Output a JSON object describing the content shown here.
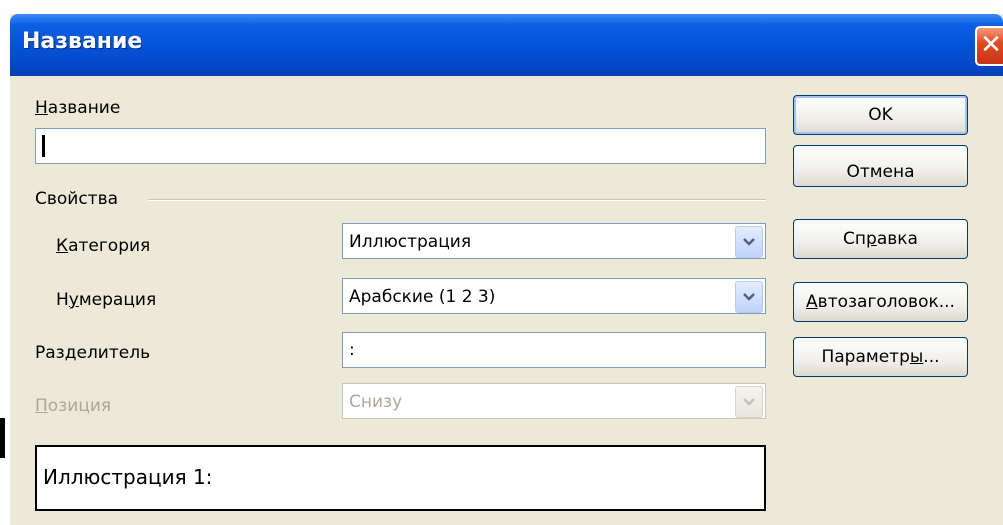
{
  "dialog": {
    "title": "Название",
    "close_glyph": "✕"
  },
  "name_field": {
    "label_underlined": "Н",
    "label_rest": "азвание",
    "value": ""
  },
  "properties": {
    "group_label": "Свойства",
    "category": {
      "label_underlined": "К",
      "label_rest": "атегория",
      "value": "Иллюстрация"
    },
    "numbering": {
      "label_pre": "Н",
      "label_underlined": "у",
      "label_rest": "мерация",
      "value": "Арабские (1 2 3)"
    },
    "separator": {
      "label_pre": "Раз",
      "label_underlined": "д",
      "label_rest": "елитель",
      "value": ":"
    },
    "position": {
      "label_underlined": "П",
      "label_rest": "озиция",
      "value": "Снизу"
    }
  },
  "preview_text": "Иллюстрация 1:",
  "buttons": {
    "ok": "OK",
    "cancel": "Отмена",
    "help_pre": "Сп",
    "help_underlined": "р",
    "help_rest": "авка",
    "autocaption_underlined": "А",
    "autocaption_rest": "втозаголовок...",
    "options_pre": "Параметр",
    "options_underlined": "ы",
    "options_rest": "..."
  },
  "icons": {
    "close": "close-icon",
    "dropdown": "chevron-down-icon"
  },
  "colors": {
    "titlebar": "#0553d8",
    "dialog_bg": "#ece9d8",
    "close_button": "#e24c22",
    "button_border": "#003c74",
    "field_border": "#7f9db9",
    "disabled_text": "#aca899"
  }
}
